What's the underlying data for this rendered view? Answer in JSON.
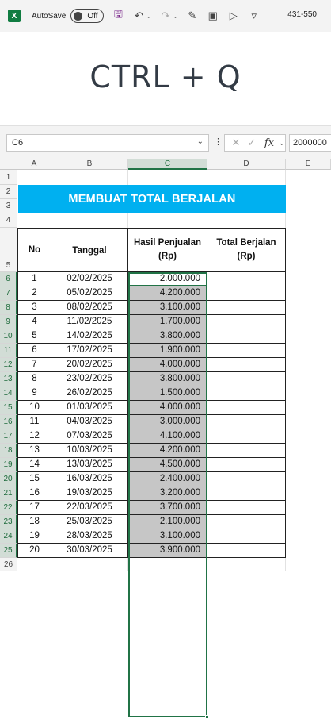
{
  "titlebar": {
    "logo": "X",
    "autosave_label": "AutoSave",
    "toggle_state": "Off",
    "dims": "431-550",
    "icons": [
      "save-icon",
      "undo-icon",
      "redo-icon",
      "format-painter-icon",
      "camera-icon",
      "present-icon",
      "customize-icon"
    ]
  },
  "banner": {
    "text": "CTRL + Q"
  },
  "formulabar": {
    "namebox": "C6",
    "fx_label": "fx",
    "formula_value": "2000000"
  },
  "columns": [
    "A",
    "B",
    "C",
    "D",
    "E"
  ],
  "rows": [
    "1",
    "2",
    "3",
    "4",
    "5",
    "6",
    "7",
    "8",
    "9",
    "10",
    "11",
    "12",
    "13",
    "14",
    "15",
    "16",
    "17",
    "18",
    "19",
    "20",
    "21",
    "22",
    "23",
    "24",
    "25",
    "26"
  ],
  "sheet": {
    "title": "MEMBUAT TOTAL BERJALAN",
    "headers": {
      "no": "No",
      "tanggal": "Tanggal",
      "hasil_line1": "Hasil Penjualan",
      "hasil_line2": "(Rp)",
      "total_line1": "Total Berjalan",
      "total_line2": "(Rp)"
    },
    "data": [
      {
        "no": "1",
        "tanggal": "02/02/2025",
        "hasil": "2.000.000",
        "total": ""
      },
      {
        "no": "2",
        "tanggal": "05/02/2025",
        "hasil": "4.200.000",
        "total": ""
      },
      {
        "no": "3",
        "tanggal": "08/02/2025",
        "hasil": "3.100.000",
        "total": ""
      },
      {
        "no": "4",
        "tanggal": "11/02/2025",
        "hasil": "1.700.000",
        "total": ""
      },
      {
        "no": "5",
        "tanggal": "14/02/2025",
        "hasil": "3.800.000",
        "total": ""
      },
      {
        "no": "6",
        "tanggal": "17/02/2025",
        "hasil": "1.900.000",
        "total": ""
      },
      {
        "no": "7",
        "tanggal": "20/02/2025",
        "hasil": "4.000.000",
        "total": ""
      },
      {
        "no": "8",
        "tanggal": "23/02/2025",
        "hasil": "3.800.000",
        "total": ""
      },
      {
        "no": "9",
        "tanggal": "26/02/2025",
        "hasil": "1.500.000",
        "total": ""
      },
      {
        "no": "10",
        "tanggal": "01/03/2025",
        "hasil": "4.000.000",
        "total": ""
      },
      {
        "no": "11",
        "tanggal": "04/03/2025",
        "hasil": "3.000.000",
        "total": ""
      },
      {
        "no": "12",
        "tanggal": "07/03/2025",
        "hasil": "4.100.000",
        "total": ""
      },
      {
        "no": "13",
        "tanggal": "10/03/2025",
        "hasil": "4.200.000",
        "total": ""
      },
      {
        "no": "14",
        "tanggal": "13/03/2025",
        "hasil": "4.500.000",
        "total": ""
      },
      {
        "no": "15",
        "tanggal": "16/03/2025",
        "hasil": "2.400.000",
        "total": ""
      },
      {
        "no": "16",
        "tanggal": "19/03/2025",
        "hasil": "3.200.000",
        "total": ""
      },
      {
        "no": "17",
        "tanggal": "22/03/2025",
        "hasil": "3.700.000",
        "total": ""
      },
      {
        "no": "18",
        "tanggal": "25/03/2025",
        "hasil": "2.100.000",
        "total": ""
      },
      {
        "no": "19",
        "tanggal": "28/03/2025",
        "hasil": "3.100.000",
        "total": ""
      },
      {
        "no": "20",
        "tanggal": "30/03/2025",
        "hasil": "3.900.000",
        "total": ""
      }
    ]
  },
  "colors": {
    "excel_green": "#217346",
    "title_fill": "#00b0f0",
    "selection_shade": "#c6c6c6"
  }
}
